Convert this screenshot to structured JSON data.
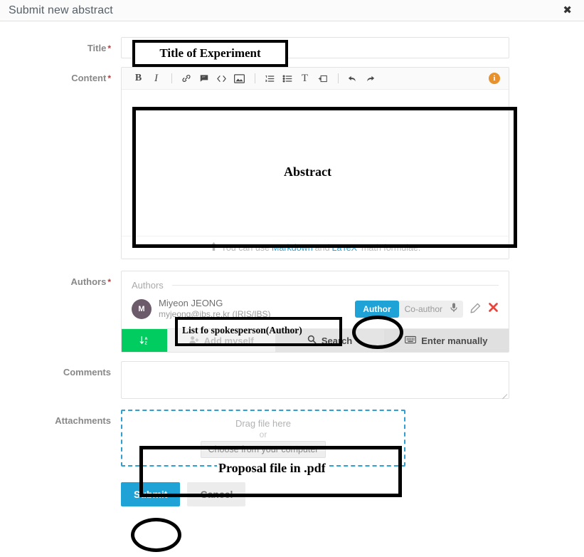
{
  "header": {
    "title": "Submit new abstract",
    "close_label": "✖"
  },
  "form": {
    "labels": {
      "title": "Title",
      "content": "Content",
      "authors": "Authors",
      "comments": "Comments",
      "attachments": "Attachments"
    },
    "required_mark": "*"
  },
  "title_field": {
    "value": "",
    "placeholder": ""
  },
  "editor": {
    "toolbar": [
      {
        "name": "bold-icon",
        "glyph": "B"
      },
      {
        "name": "italic-icon",
        "glyph": "I"
      },
      {
        "name": "link-icon",
        "glyph": "🔗"
      },
      {
        "name": "quote-icon",
        "glyph": "❝"
      },
      {
        "name": "code-icon",
        "glyph": "<>"
      },
      {
        "name": "image-icon",
        "glyph": "⛰"
      },
      {
        "name": "ordered-list-icon",
        "glyph": "≡"
      },
      {
        "name": "unordered-list-icon",
        "glyph": "☰"
      },
      {
        "name": "heading-icon",
        "glyph": "T"
      },
      {
        "name": "indent-icon",
        "glyph": "⤇"
      },
      {
        "name": "undo-icon",
        "glyph": "↶"
      },
      {
        "name": "redo-icon",
        "glyph": "↷"
      },
      {
        "name": "info-icon",
        "glyph": "i"
      }
    ],
    "content": "",
    "footer_prefix": "You can use",
    "footer_markdown": "Markdown",
    "footer_and": "and",
    "footer_latex": "LaTeX",
    "footer_suffix": "math formulae.",
    "upload_arrow": "⬆"
  },
  "authors": {
    "legend": "Authors",
    "list": [
      {
        "initial": "M",
        "name": "Miyeon JEONG",
        "email": "myjeong@ibs.re.kr (IRIS/IBS)",
        "role_active": "Author",
        "role_inactive": "Co-author",
        "mic_icon": "🎤",
        "edit_icon": "✎",
        "delete_icon": "✖"
      }
    ],
    "actions": {
      "sort": "↓ᴀᶻ",
      "add_myself": "Add myself",
      "add_myself_icon": "👤+",
      "search": "Search",
      "search_icon": "⚲",
      "enter_manually": "Enter manually",
      "keyboard_icon": "⌨"
    }
  },
  "comments": {
    "value": "",
    "placeholder": ""
  },
  "attachments": {
    "drag_text": "Drag file here",
    "or_text": "or",
    "choose_button": "Choose from your computer"
  },
  "footer": {
    "submit": "Submit",
    "cancel": "Cancel"
  },
  "annotations": {
    "title_note": "Title of Experiment",
    "abstract_note": "Abstract",
    "spokesperson_note": "List fo spokesperson(Author)",
    "proposal_note": "Proposal file in .pdf"
  },
  "colors": {
    "accent_blue": "#1fa2d6",
    "green": "#00cc5f",
    "red": "#ef4136",
    "required_red": "#cc3333",
    "annotation_black": "#000000",
    "dropzone_blue": "#2e9fd0"
  }
}
